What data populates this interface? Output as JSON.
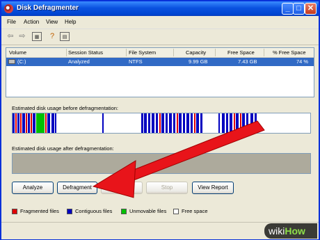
{
  "window": {
    "title": "Disk Defragmenter"
  },
  "menu": [
    "File",
    "Action",
    "View",
    "Help"
  ],
  "toolbar": [
    "back-arrow-icon",
    "forward-arrow-icon",
    "properties-icon",
    "help-icon",
    "console-icon"
  ],
  "list": {
    "headers": [
      "Volume",
      "Session Status",
      "File System",
      "Capacity",
      "Free Space",
      "% Free Space"
    ],
    "rows": [
      {
        "volume": "(C:)",
        "status": "Analyzed",
        "fs": "NTFS",
        "capacity": "9.99 GB",
        "free": "7.43 GB",
        "pct": "74 %"
      }
    ]
  },
  "labels": {
    "before": "Estimated disk usage before defragmentation:",
    "after": "Estimated disk usage after defragmentation:"
  },
  "buttons": {
    "analyze": "Analyze",
    "defragment": "Defragment",
    "pause": "",
    "stop": "Stop",
    "view_report": "View Report"
  },
  "legend": [
    {
      "label": "Fragmented files",
      "color": "#E00000"
    },
    {
      "label": "Contiguous files",
      "color": "#0000C0"
    },
    {
      "label": "Unmovable files",
      "color": "#00C000"
    },
    {
      "label": "Free space",
      "color": "#FFFFFF"
    }
  ],
  "colors": {
    "titlebar": "#0A52E0",
    "selection": "#316AC5",
    "arrow": "#E8141A"
  },
  "watermark": {
    "part1": "wiki",
    "part2": "How"
  }
}
